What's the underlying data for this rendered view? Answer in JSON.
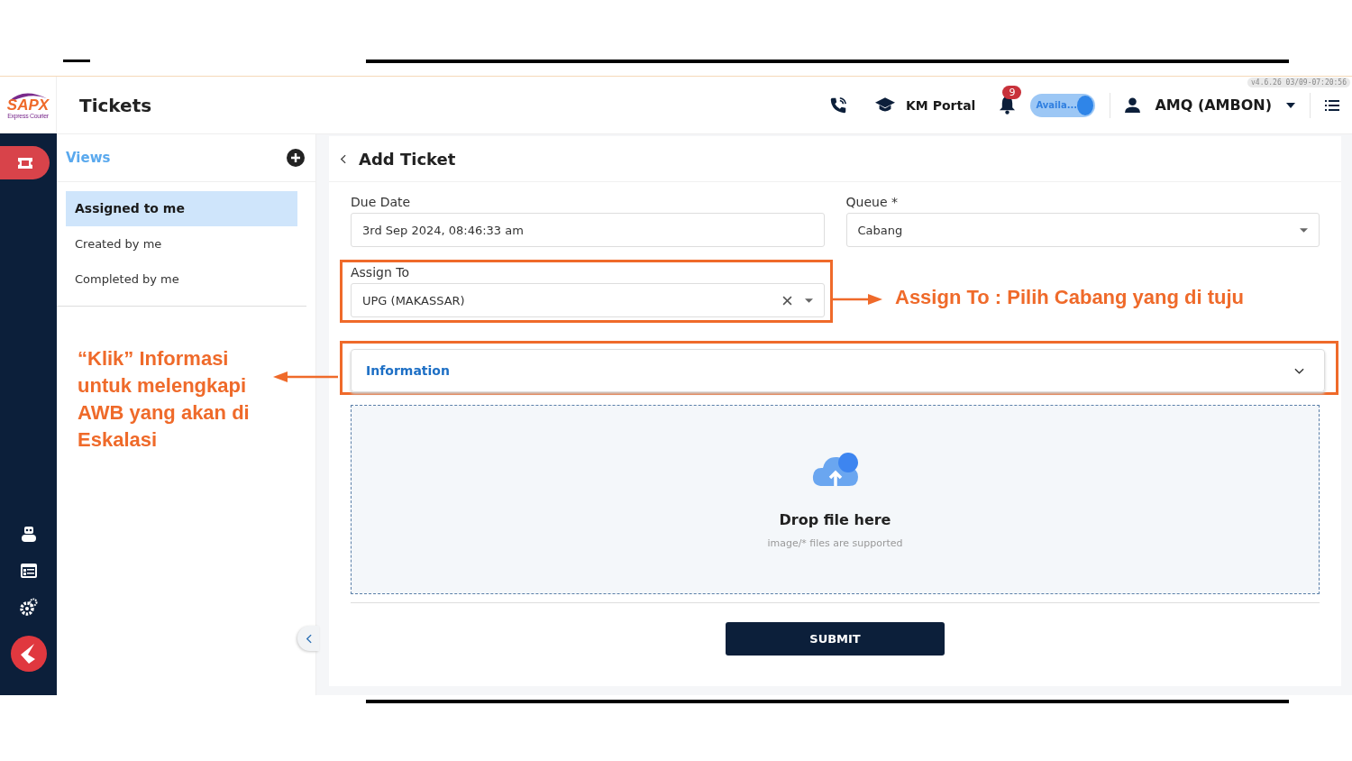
{
  "logo": {
    "name": "SAPX",
    "tagline": "Express Courier"
  },
  "header": {
    "title": "Tickets",
    "km_portal": "KM Portal",
    "notification_count": "9",
    "availability": {
      "label": "Availa...",
      "on": true
    },
    "user": "AMQ (AMBON)",
    "version": "v4.6.26 03/09-07:20:56"
  },
  "rail": [
    {
      "kind": "ticket",
      "selected": true
    },
    {
      "kind": "bot",
      "selected": false
    },
    {
      "kind": "list",
      "selected": false
    },
    {
      "kind": "gears",
      "selected": false
    },
    {
      "kind": "app",
      "selected": false
    }
  ],
  "views": {
    "title": "Views",
    "items": [
      {
        "label": "Assigned to me",
        "selected": true
      },
      {
        "label": "Created by me",
        "selected": false
      },
      {
        "label": "Completed by me",
        "selected": false
      }
    ]
  },
  "form": {
    "title": "Add Ticket",
    "fields": [
      {
        "kind": "text",
        "label": "Due Date",
        "value": "3rd Sep 2024, 08:46:33 am"
      },
      {
        "kind": "select",
        "label": "Queue *",
        "value": "Cabang"
      },
      {
        "kind": "clearable_select",
        "label": "Assign To",
        "value": "UPG (MAKASSAR)"
      }
    ],
    "section": {
      "label": "Information",
      "expanded": false
    },
    "dropzone": {
      "title": "Drop file here",
      "hint": "image/* files are supported"
    },
    "submit": "SUBMIT"
  },
  "annotations": [
    {
      "text": "Assign To : Pilih Cabang yang di tuju"
    },
    {
      "text": "“Klik” Informasi untuk melengkapi AWB yang akan di Eskalasi"
    }
  ]
}
